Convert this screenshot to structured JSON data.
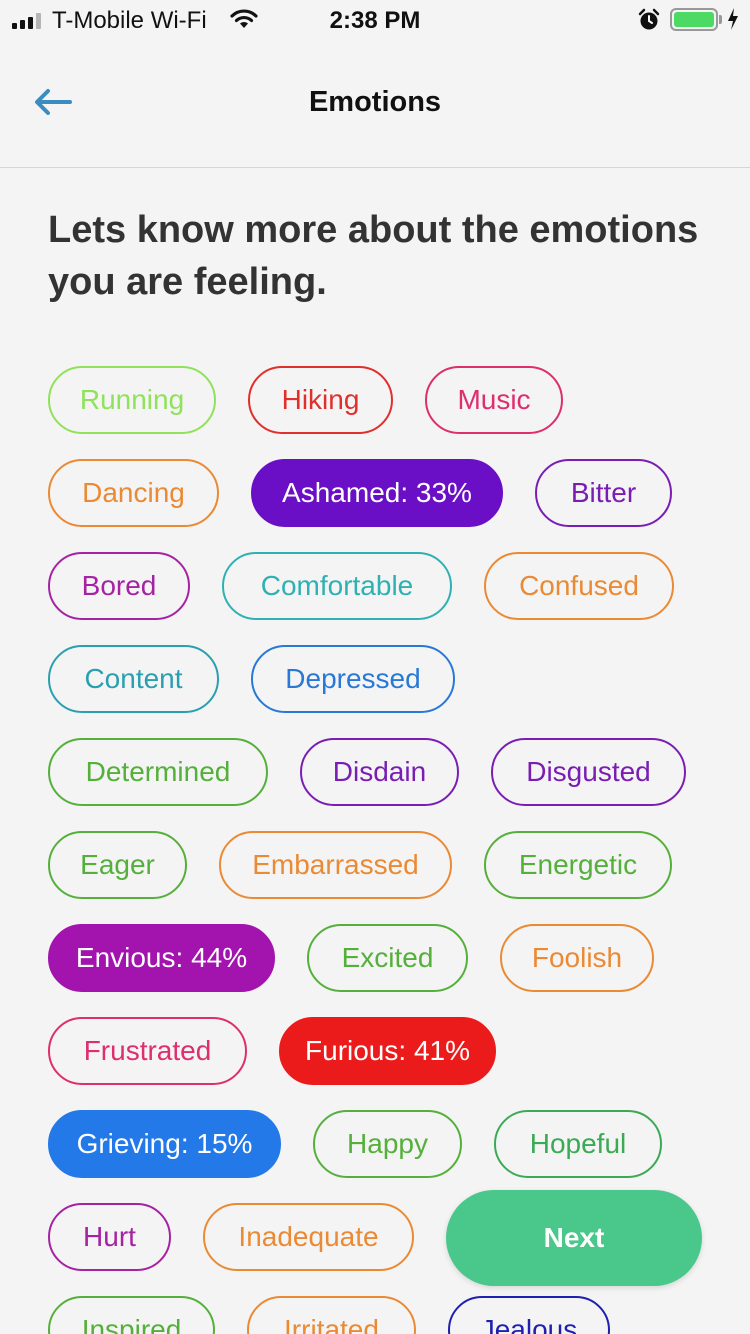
{
  "status_bar": {
    "carrier": "T-Mobile Wi-Fi",
    "time": "2:38 PM",
    "wifi_icon": "wifi-icon",
    "alarm_icon": "alarm-clock-icon",
    "battery_icon": "battery-icon",
    "battery_level": 1.0,
    "charging_icon": "lightning-bolt-icon"
  },
  "nav": {
    "back_icon": "back-arrow-icon",
    "title": "Emotions"
  },
  "prompt": "Lets know more about the emotions you are feeling.",
  "chips": [
    {
      "label": "Running",
      "color": "#8fe25a",
      "selected": false
    },
    {
      "label": "Hiking",
      "color": "#e0302d",
      "selected": false
    },
    {
      "label": "Music",
      "color": "#dd2e6e",
      "selected": false
    },
    {
      "label": "Dancing",
      "color": "#ea8a34",
      "selected": false
    },
    {
      "label": "Ashamed: 33%",
      "color": "#6a0fc6",
      "selected": true
    },
    {
      "label": "Bitter",
      "color": "#7a1eb3",
      "selected": false
    },
    {
      "label": "Bored",
      "color": "#a523a3",
      "selected": false
    },
    {
      "label": "Comfortable",
      "color": "#2fb1b3",
      "selected": false
    },
    {
      "label": "Confused",
      "color": "#ea8a34",
      "selected": false
    },
    {
      "label": "Content",
      "color": "#2a9fb0",
      "selected": false
    },
    {
      "label": "Depressed",
      "color": "#2879d6",
      "selected": false
    },
    {
      "label": "Determined",
      "color": "#55b03b",
      "selected": false
    },
    {
      "label": "Disdain",
      "color": "#7a1eb3",
      "selected": false
    },
    {
      "label": "Disgusted",
      "color": "#7a1eb3",
      "selected": false
    },
    {
      "label": "Eager",
      "color": "#55b03b",
      "selected": false
    },
    {
      "label": "Embarrassed",
      "color": "#ea8a34",
      "selected": false
    },
    {
      "label": "Energetic",
      "color": "#55b03b",
      "selected": false
    },
    {
      "label": "Envious: 44%",
      "color": "#a313ae",
      "selected": true
    },
    {
      "label": "Excited",
      "color": "#55b03b",
      "selected": false
    },
    {
      "label": "Foolish",
      "color": "#ea8a34",
      "selected": false
    },
    {
      "label": "Frustrated",
      "color": "#dd2e6e",
      "selected": false
    },
    {
      "label": "Furious: 41%",
      "color": "#ec1b1b",
      "selected": true
    },
    {
      "label": "Grieving: 15%",
      "color": "#2479e8",
      "selected": true
    },
    {
      "label": "Happy",
      "color": "#55b03b",
      "selected": false
    },
    {
      "label": "Hopeful",
      "color": "#3aaa55",
      "selected": false
    },
    {
      "label": "Hurt",
      "color": "#a523a3",
      "selected": false
    },
    {
      "label": "Inadequate",
      "color": "#ea8a34",
      "selected": false
    },
    {
      "label": "Inspired",
      "color": "#55b03b",
      "selected": false
    },
    {
      "label": "Irritated",
      "color": "#ea8a34",
      "selected": false
    },
    {
      "label": "Jealous",
      "color": "#1f1fb0",
      "selected": false
    }
  ],
  "next_button": {
    "label": "Next"
  }
}
